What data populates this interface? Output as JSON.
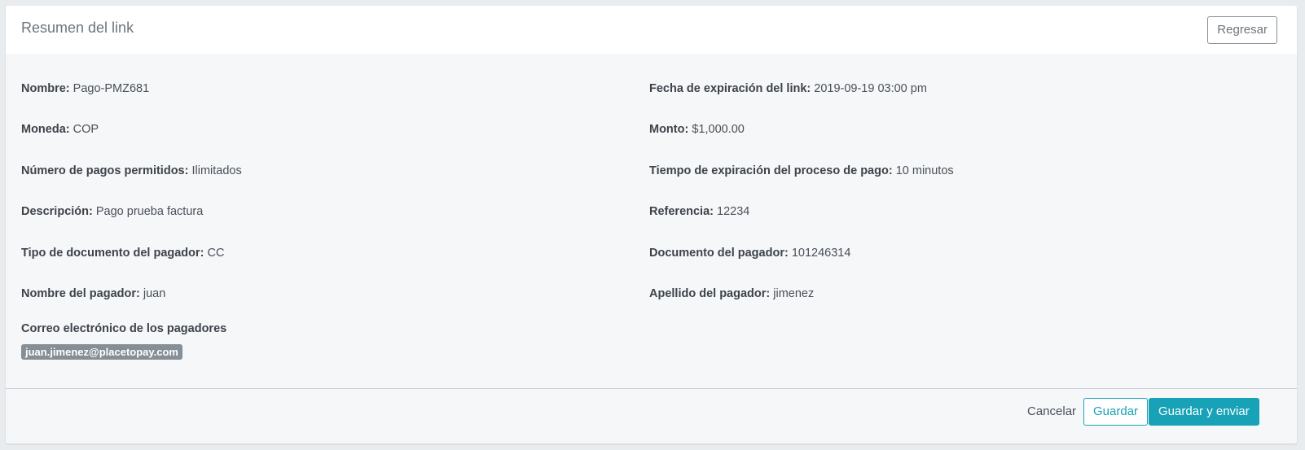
{
  "header": {
    "title": "Resumen del link",
    "back_label": "Regresar"
  },
  "details": {
    "left": [
      {
        "label": "Nombre:",
        "value": "Pago-PMZ681"
      },
      {
        "label": "Moneda:",
        "value": "COP"
      },
      {
        "label": "Número de pagos permitidos:",
        "value": "Ilimitados"
      },
      {
        "label": "Descripción:",
        "value": "Pago prueba factura"
      },
      {
        "label": "Tipo de documento del pagador:",
        "value": "CC"
      },
      {
        "label": "Nombre del pagador:",
        "value": "juan"
      }
    ],
    "right": [
      {
        "label": "Fecha de expiración del link:",
        "value": "2019-09-19 03:00 pm"
      },
      {
        "label": "Monto:",
        "value": "$1,000.00"
      },
      {
        "label": "Tiempo de expiración del proceso de pago:",
        "value": "10 minutos"
      },
      {
        "label": "Referencia:",
        "value": "12234"
      },
      {
        "label": "Documento del pagador:",
        "value": "101246314"
      },
      {
        "label": "Apellido del pagador:",
        "value": "jimenez"
      }
    ]
  },
  "emails": {
    "label": "Correo electrónico de los pagadores",
    "items": [
      "juan.jimenez@placetopay.com"
    ]
  },
  "footer": {
    "cancel_label": "Cancelar",
    "save_label": "Guardar",
    "save_send_label": "Guardar y enviar"
  },
  "colors": {
    "accent": "#17a2b8",
    "badge": "#868e96",
    "background": "#f5f7f9"
  }
}
